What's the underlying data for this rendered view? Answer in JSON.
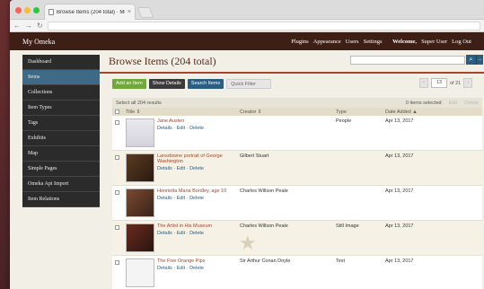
{
  "browser": {
    "tab_title": "Browse Items (204 total) · Mi",
    "tab_close": "×"
  },
  "admin_header": {
    "site_name": "My Omeka",
    "nav": [
      "Plugins",
      "Appearance",
      "Users",
      "Settings"
    ],
    "welcome": "Welcome,",
    "user": "Super User",
    "logout": "Log Out"
  },
  "sidebar": {
    "items": [
      {
        "label": "Dashboard"
      },
      {
        "label": "Items",
        "active": true
      },
      {
        "label": "Collections"
      },
      {
        "label": "Item Types"
      },
      {
        "label": "Tags"
      },
      {
        "label": "Exhibits"
      },
      {
        "label": "Map"
      },
      {
        "label": "Simple Pages"
      },
      {
        "label": "Omeka Api Import"
      },
      {
        "label": "Item Relations"
      }
    ]
  },
  "page": {
    "title": "Browse Items (204 total)",
    "search_icon": "search-icon",
    "search_dropdown": "..."
  },
  "toolbar": {
    "add": "Add an Item",
    "details": "Show Details",
    "search_items": "Search Items",
    "quick_filter": "Quick Filter"
  },
  "pager": {
    "current": "13",
    "of": "of 21",
    "prev": "‹",
    "next": "›"
  },
  "table": {
    "select_all": "Select all 204 results",
    "items_selected": "0 items selected",
    "edit": "Edit",
    "delete": "Delete",
    "headers": {
      "title": "Title ⇕",
      "creator": "Creator ⇕",
      "type": "Type",
      "date": "Date Added ▲"
    },
    "rows": [
      {
        "title": "Jane Austen",
        "creator": "",
        "type": "People",
        "date": "Apr 13, 2017",
        "actions": "Details · Edit · Delete"
      },
      {
        "title": "Lansdowne portrait of George Washington",
        "creator": "Gilbert Stuart",
        "type": "",
        "date": "Apr 13, 2017",
        "actions": "Details · Edit · Delete"
      },
      {
        "title": "Henrietta Maria Bordley, age 10",
        "creator": "Charles Willson Peale",
        "type": "",
        "date": "Apr 13, 2017",
        "actions": "Details · Edit · Delete"
      },
      {
        "title": "The Artist in His Museum",
        "creator": "Charles Willson Peale",
        "type": "Still Image",
        "date": "Apr 13, 2017",
        "actions": "Details · Edit · Delete"
      },
      {
        "title": "The Five Orange Pips",
        "creator": "Sir Arthur Conan Doyle",
        "type": "Text",
        "date": "Apr 13, 2017",
        "actions": "Details · Edit · Delete"
      }
    ]
  }
}
